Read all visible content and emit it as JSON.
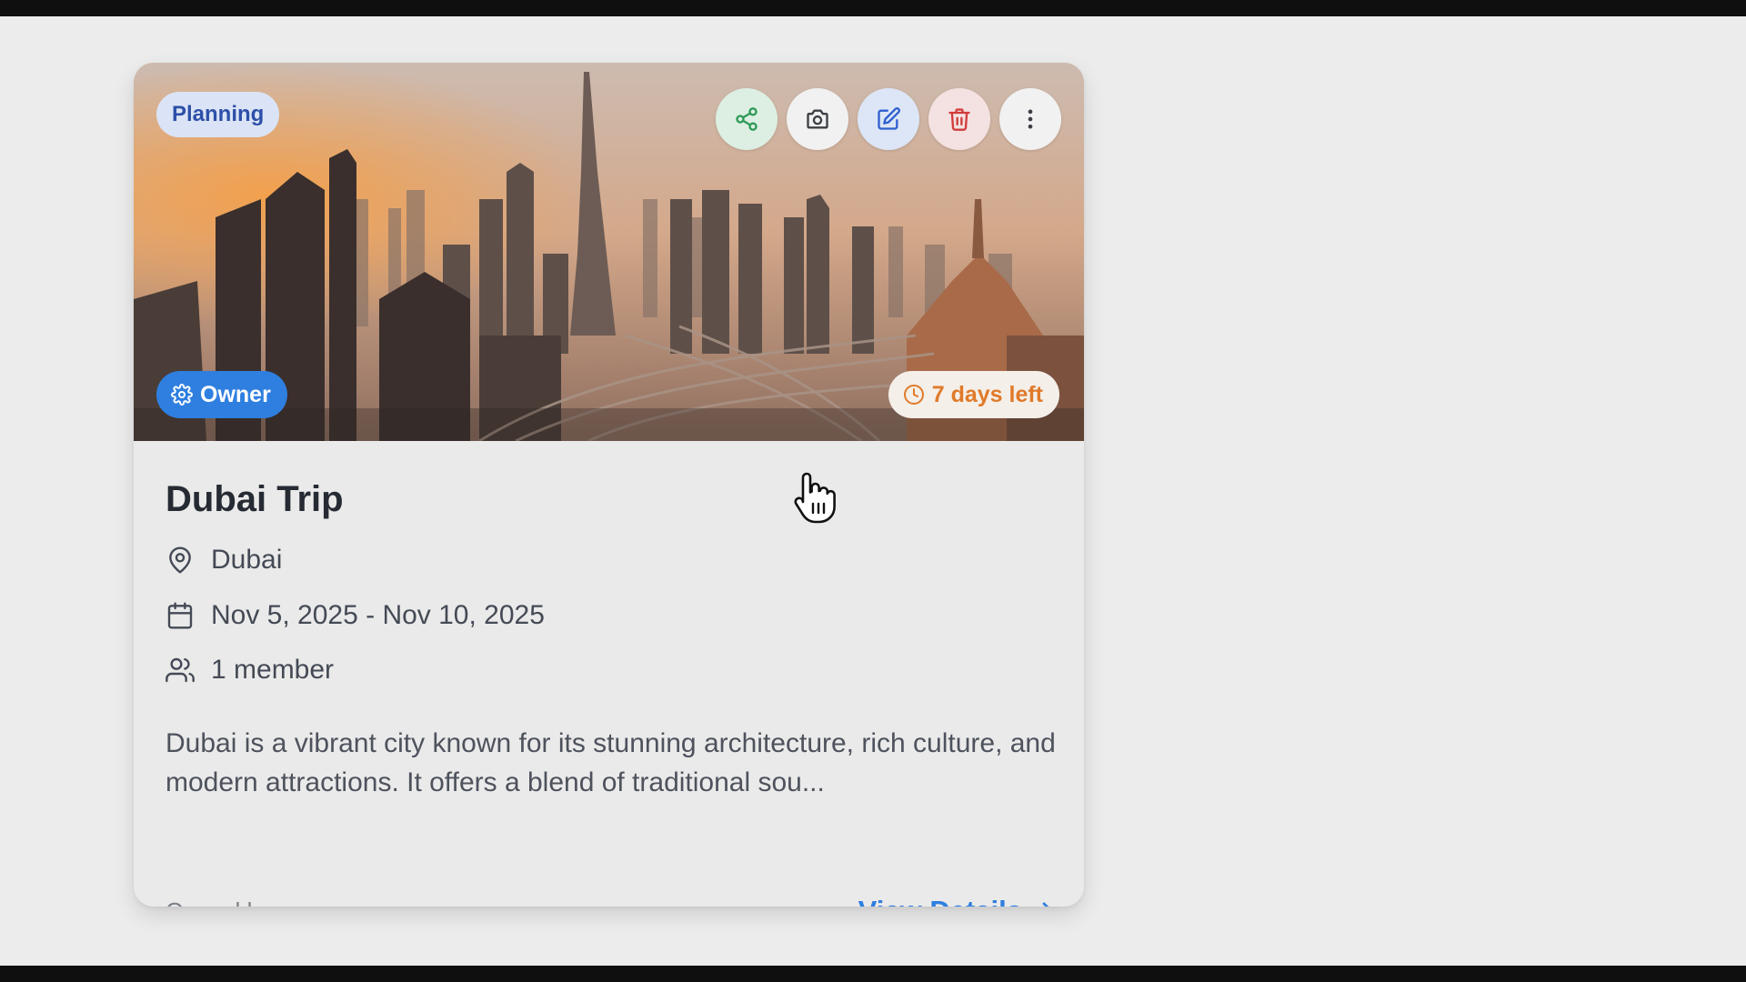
{
  "card": {
    "status_badge": "Planning",
    "role_badge": "Owner",
    "time_left": "7 days left",
    "title": "Dubai Trip",
    "location": "Dubai",
    "dates": "Nov 5, 2025 - Nov 10, 2025",
    "members": "1 member",
    "description": "Dubai is a vibrant city known for its stunning architecture, rich culture, and modern attractions. It offers a blend of traditional sou...",
    "owner_text": "Owned by you",
    "view_details": "View Details",
    "actions": [
      "share-icon",
      "camera-icon",
      "edit-icon",
      "trash-icon",
      "more-vertical-icon"
    ]
  },
  "colors": {
    "accent_blue": "#2f7fe0",
    "status_badge_bg": "#dbe4f6",
    "time_left_text": "#e07a2a",
    "share_green": "#2e9a57",
    "delete_red": "#d23b3b"
  }
}
